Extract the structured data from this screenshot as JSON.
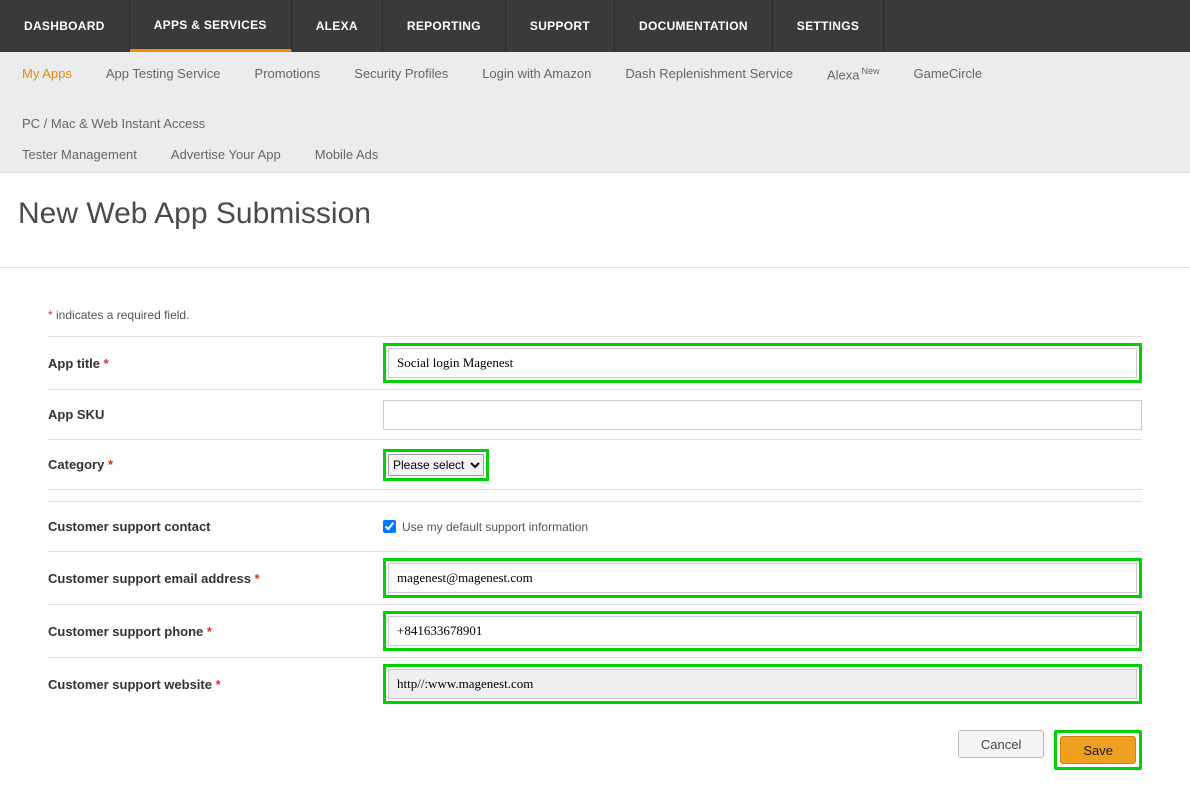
{
  "topnav": {
    "items": [
      {
        "label": "DASHBOARD"
      },
      {
        "label": "APPS & SERVICES",
        "active": true
      },
      {
        "label": "ALEXA"
      },
      {
        "label": "REPORTING"
      },
      {
        "label": "SUPPORT"
      },
      {
        "label": "DOCUMENTATION"
      },
      {
        "label": "SETTINGS"
      }
    ]
  },
  "subnav": {
    "row1": [
      {
        "label": "My Apps",
        "active": true
      },
      {
        "label": "App Testing Service"
      },
      {
        "label": "Promotions"
      },
      {
        "label": "Security Profiles"
      },
      {
        "label": "Login with Amazon"
      },
      {
        "label": "Dash Replenishment Service"
      },
      {
        "label": "Alexa",
        "badge": "New"
      },
      {
        "label": "GameCircle"
      },
      {
        "label": "PC / Mac & Web Instant Access"
      }
    ],
    "row2": [
      {
        "label": "Tester Management"
      },
      {
        "label": "Advertise Your App"
      },
      {
        "label": "Mobile Ads"
      }
    ]
  },
  "page": {
    "title": "New Web App Submission",
    "required_note": "indicates a required field."
  },
  "form": {
    "app_title": {
      "label": "App title",
      "value": "Social login Magenest",
      "required": true
    },
    "app_sku": {
      "label": "App SKU",
      "value": ""
    },
    "category": {
      "label": "Category",
      "selected": "Please select",
      "required": true
    },
    "support_contact": {
      "label": "Customer support contact",
      "checkbox_label": "Use my default support information",
      "checked": true
    },
    "support_email": {
      "label": "Customer support email address",
      "value": "magenest@magenest.com",
      "required": true
    },
    "support_phone": {
      "label": "Customer support phone",
      "value": "+841633678901",
      "required": true
    },
    "support_website": {
      "label": "Customer support website",
      "value": "http//:www.magenest.com",
      "required": true
    }
  },
  "buttons": {
    "cancel": "Cancel",
    "save": "Save"
  }
}
